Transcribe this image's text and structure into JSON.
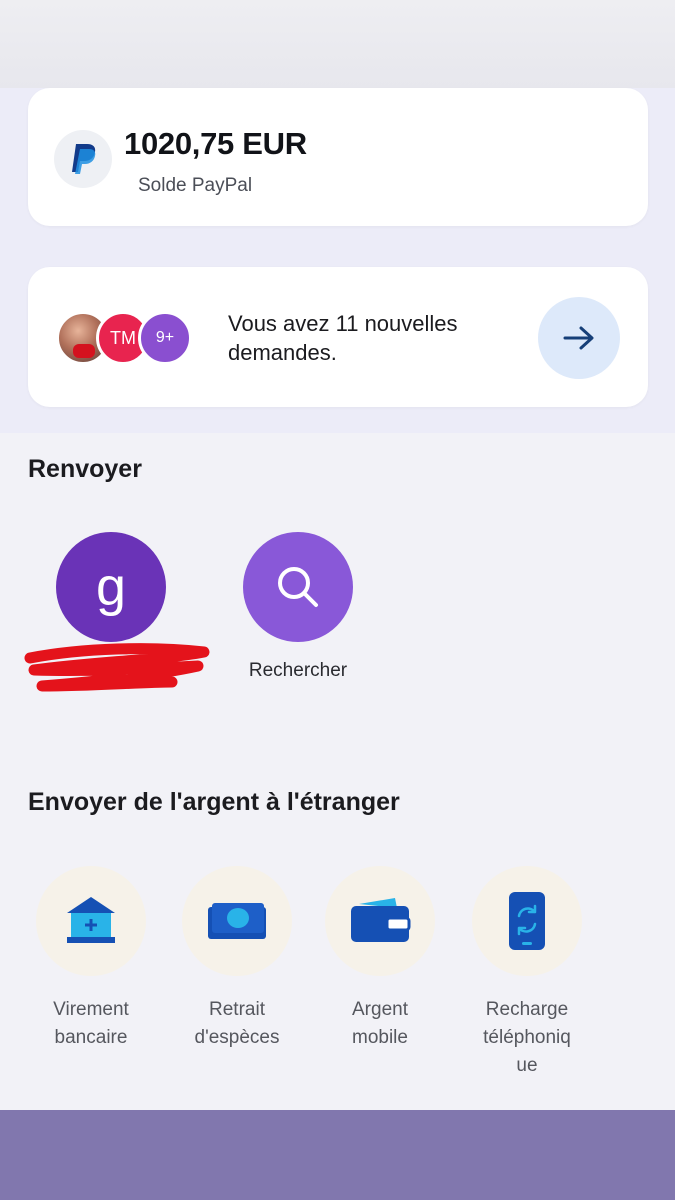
{
  "balance": {
    "amount": "1020,75 EUR",
    "label": "Solde PayPal",
    "logo_icon": "paypal-logo"
  },
  "requests": {
    "avatars": [
      {
        "type": "photo"
      },
      {
        "initials": "TM",
        "color": "#e8244f"
      },
      {
        "initials": "9+",
        "color": "#8a4fd0"
      }
    ],
    "text": "Vous avez 11 nouvelles demandes.",
    "action_icon": "arrow-right-icon"
  },
  "resend": {
    "title": "Renvoyer",
    "contacts": [
      {
        "initial": "g",
        "color": "#6a33b7",
        "label_redacted": true
      },
      {
        "icon": "search-icon",
        "label": "Rechercher",
        "color": "#8958d8"
      }
    ]
  },
  "abroad": {
    "title": "Envoyer de l'argent à l'étranger",
    "options": [
      {
        "icon": "bank-icon",
        "label_line1": "Virement",
        "label_line2": "bancaire"
      },
      {
        "icon": "cash-icon",
        "label_line1": "Retrait",
        "label_line2": "d'espèces"
      },
      {
        "icon": "wallet-icon",
        "label_line1": "Argent",
        "label_line2": "mobile"
      },
      {
        "icon": "phone-recharge-icon",
        "label_line1": "Recharge",
        "label_line2": "téléphoniq",
        "label_line3": "ue"
      }
    ]
  },
  "colors": {
    "accent_blue": "#1550b4",
    "purple": "#6a33b7",
    "bottom_bar": "#8177ae"
  }
}
